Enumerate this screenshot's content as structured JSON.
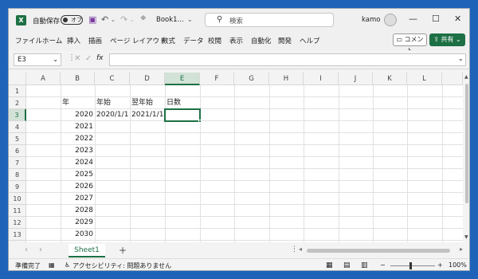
{
  "titlebar": {
    "autosave_label": "自動保存",
    "autosave_state": "オフ",
    "file_name": "Book1...",
    "search_placeholder": "検索",
    "user_name": "kamo"
  },
  "ribbon_tabs": [
    "ファイル",
    "ホーム",
    "挿入",
    "描画",
    "ページ レイアウト",
    "数式",
    "データ",
    "校閲",
    "表示",
    "自動化",
    "開発",
    "ヘルプ"
  ],
  "comment_label": "コメント",
  "share_label": "共有",
  "name_box": "E3",
  "fx_label": "fx",
  "columns": [
    "A",
    "B",
    "C",
    "D",
    "E",
    "F",
    "G",
    "H",
    "I",
    "J",
    "K",
    "L"
  ],
  "selected_column": "E",
  "rows": [
    "1",
    "2",
    "3",
    "4",
    "5",
    "6",
    "7",
    "8",
    "9",
    "10",
    "11",
    "12",
    "13",
    "14"
  ],
  "selected_row": "3",
  "cells": {
    "b2": "年",
    "c2": "年始",
    "d2": "翌年始",
    "e2": "日数",
    "c3": "2020/1/1",
    "d3": "2021/1/1",
    "years": [
      "2020",
      "2021",
      "2022",
      "2023",
      "2024",
      "2025",
      "2026",
      "2027",
      "2028",
      "2029",
      "2030"
    ]
  },
  "sheet_tab": "Sheet1",
  "status": {
    "ready": "準備完了",
    "accessibility": "アクセシビリティ: 問題ありません",
    "zoom": "100%"
  }
}
